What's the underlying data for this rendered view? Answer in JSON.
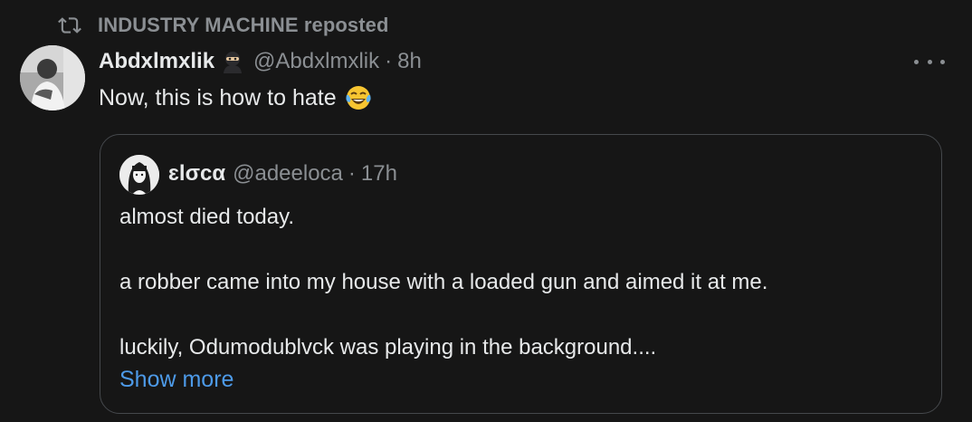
{
  "repost": {
    "text": "INDUSTRY MACHINE reposted",
    "icon": "repost-icon"
  },
  "post": {
    "author_name": "Abdxlmxlik",
    "author_badge": "ninja-emoji-icon",
    "author_handle": "@Abdxlmxlik",
    "separator": "·",
    "time": "8h",
    "text": "Now, this is how to hate",
    "emoji": "tears-of-joy-emoji",
    "more_icon": "more-options-icon"
  },
  "quote": {
    "author_name": "ɛlσcα",
    "author_handle": "@adeeloca",
    "separator": "·",
    "time": "17h",
    "lines": [
      "almost died today.",
      "a robber came into my house with a loaded gun and aimed it at me.",
      "luckily, Odumodublvck was playing in the background...."
    ],
    "show_more": "Show more"
  },
  "colors": {
    "background": "#161616",
    "text_primary": "#e7e9ea",
    "text_secondary": "#8b8f93",
    "link": "#4d9ae8",
    "border": "#45484c"
  }
}
